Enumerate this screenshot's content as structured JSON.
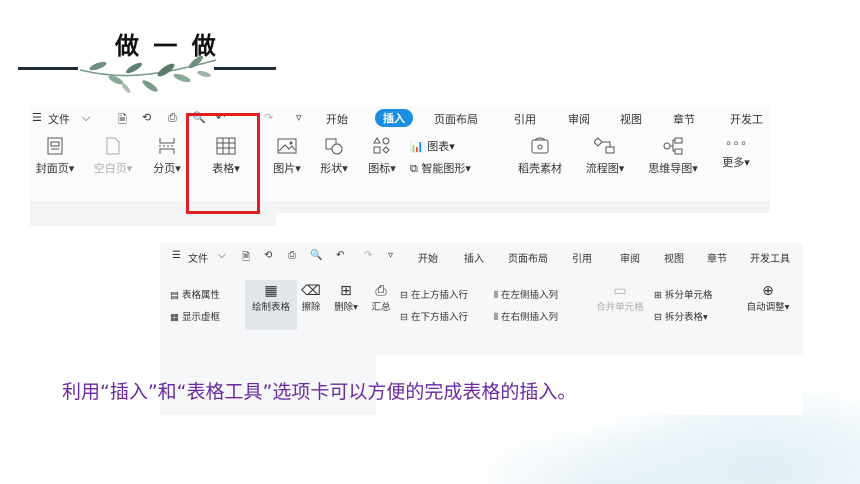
{
  "slide": {
    "title": "做 一 做",
    "caption": "利用“插入”和“表格工具”选项卡可以方便的完成表格的插入。"
  },
  "ribbon1": {
    "menu": {
      "file": "文件",
      "tabs": [
        "开始",
        "插入",
        "页面布局",
        "引用",
        "审阅",
        "视图",
        "章节",
        "开发工"
      ],
      "active_tab": "插入"
    },
    "tools": {
      "cover_page": "封面页",
      "blank_page": "空白页",
      "page_break": "分页",
      "table": "表格",
      "picture": "图片",
      "shape": "形状",
      "icon": "图标",
      "chart": "图表",
      "smart_art": "智能图形",
      "daoke_material": "稻壳素材",
      "flowchart": "流程图",
      "mind_map": "思维导图",
      "more": "更多"
    }
  },
  "ribbon2": {
    "menu": {
      "file": "文件",
      "tabs": [
        "开始",
        "插入",
        "页面布局",
        "引用",
        "审阅",
        "视图",
        "章节",
        "开发工具"
      ]
    },
    "tools": {
      "table_props": "表格属性",
      "show_gridlines": "显示虚框",
      "draw_table": "绘制表格",
      "erase": "擦除",
      "delete": "删除",
      "summary": "汇总",
      "insert_row_above": "在上方插入行",
      "insert_row_below": "在下方插入行",
      "insert_col_left": "在左侧插入列",
      "insert_col_right": "在右侧插入列",
      "merge_cells": "合并单元格",
      "split_cells": "拆分单元格",
      "split_table": "拆分表格",
      "auto_fit": "自动调整"
    }
  },
  "colors": {
    "active_tab": "#1a8fe0",
    "highlight_box": "#e02020",
    "caption_text": "#6a2aa1"
  }
}
